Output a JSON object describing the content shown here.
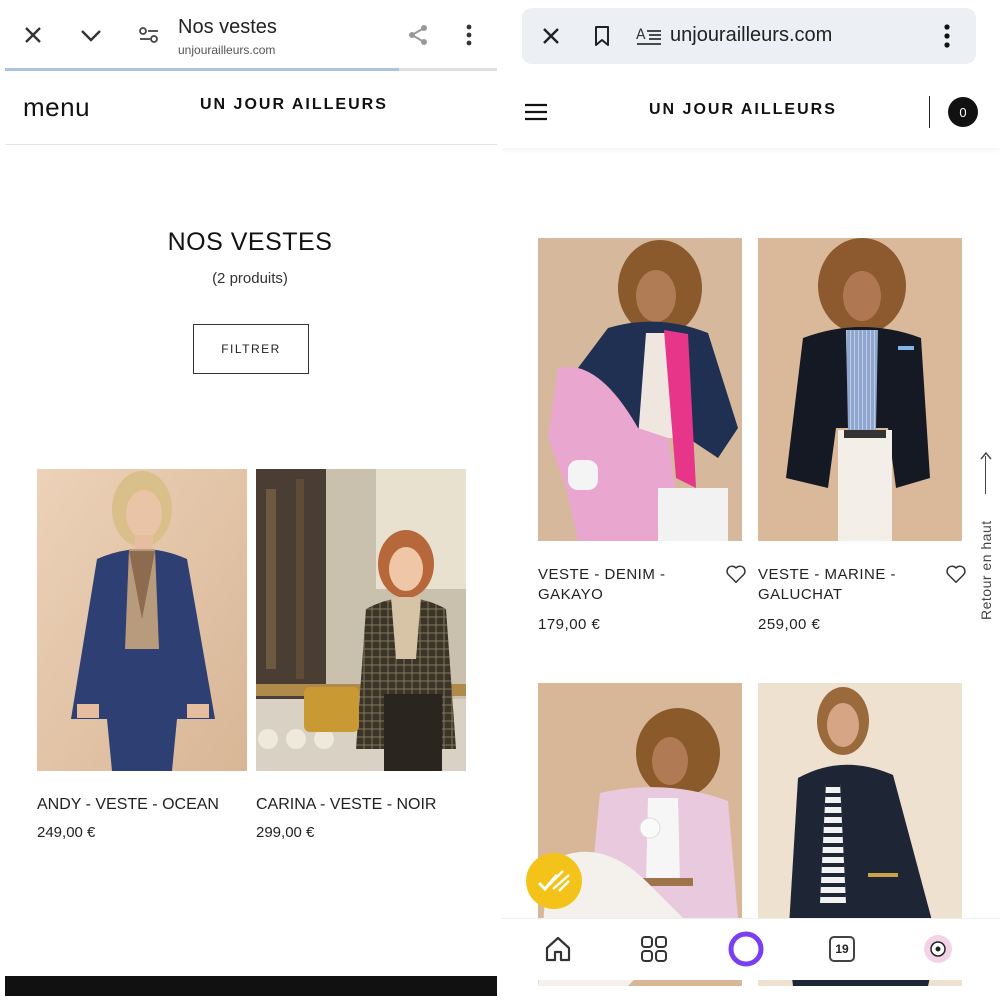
{
  "left": {
    "browser": {
      "title": "Nos vestes",
      "url": "unjourailleurs.com",
      "progress": 0.8,
      "icons": [
        "close-icon",
        "chevron-down-icon",
        "site-settings-icon",
        "share-icon",
        "more-vert-icon"
      ]
    },
    "header": {
      "menu_label": "menu",
      "brand": "UN JOUR AILLEURS"
    },
    "page": {
      "heading": "NOS VESTES",
      "count": "(2 produits)",
      "filter_label": "FILTRER"
    },
    "products": [
      {
        "name": "ANDY - VESTE - OCEAN",
        "price": "249,00 €"
      },
      {
        "name": "CARINA - VESTE - NOIR",
        "price": "299,00 €"
      }
    ]
  },
  "right": {
    "browser": {
      "url": "unjourailleurs.com",
      "icons": [
        "close-icon",
        "bookmark-icon",
        "reader-mode-icon",
        "more-vert-icon"
      ]
    },
    "header": {
      "brand": "UN JOUR AILLEURS",
      "cart_count": "0"
    },
    "products": [
      {
        "name": "VESTE - DENIM - GAKAYO",
        "price": "179,00  €"
      },
      {
        "name": "VESTE - MARINE - GALUCHAT",
        "price": "259,00  €"
      },
      {
        "name": "",
        "price": ""
      },
      {
        "name": "",
        "price": ""
      }
    ],
    "back_to_top": "Retour en haut",
    "bottom_nav": {
      "tabs_count": "19",
      "icons": [
        "home-icon",
        "apps-grid-icon",
        "assistant-icon",
        "tabs-icon",
        "profile-icon"
      ]
    }
  },
  "colors": {
    "accent_purple": "#7b3ff2",
    "badge_yellow": "#f4c31a",
    "photo_beige": "#d9b99a"
  }
}
